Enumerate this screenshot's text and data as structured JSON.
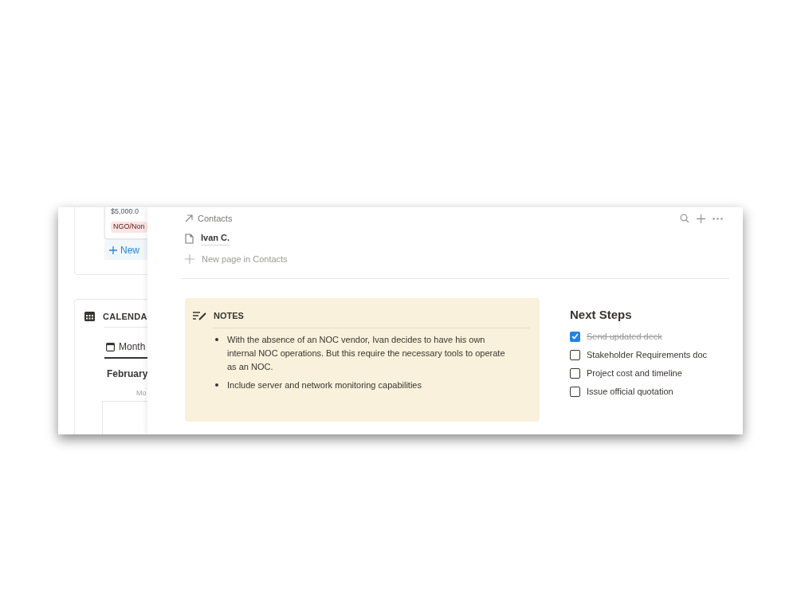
{
  "background_page": {
    "card": {
      "amount": "$5,000.0",
      "tag": "NGO/Non",
      "new_button": "New"
    },
    "calendar": {
      "title": "CALENDA",
      "view_tab": {
        "label": "Month",
        "selected": true
      },
      "month": "February",
      "weekday": "Mo"
    }
  },
  "contacts": {
    "title": "Contacts",
    "items": [
      "Ivan C."
    ],
    "new_page": "New page in Contacts"
  },
  "notes": {
    "title": "NOTES",
    "bullets": [
      "With the absence of an NOC vendor, Ivan decides to have his own internal NOC operations. But this require the necessary tools to operate as an NOC.",
      "Include server and network monitoring capabilities"
    ]
  },
  "next_steps": {
    "title": "Next Steps",
    "items": [
      {
        "label": "Send updated deck",
        "checked": true
      },
      {
        "label": "Stakeholder Requirements doc",
        "checked": false
      },
      {
        "label": "Project cost and timeline",
        "checked": false
      },
      {
        "label": "Issue official quotation",
        "checked": false
      }
    ]
  }
}
